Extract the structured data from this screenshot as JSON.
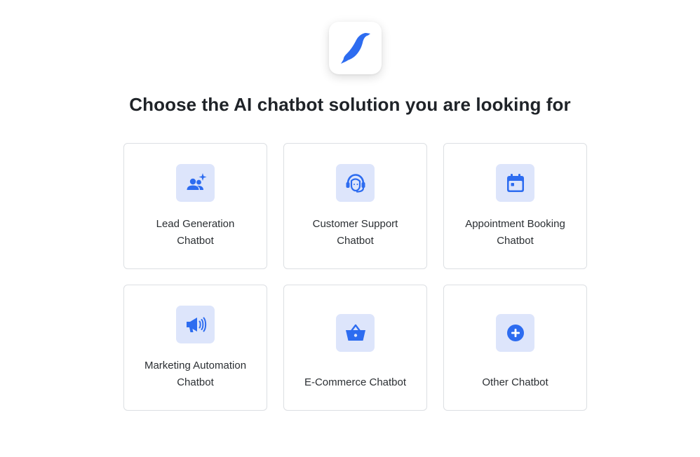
{
  "brand": {
    "accent_color": "#2d6cf0",
    "icon_tile_bg": "#dde5fb",
    "logo_icon": "bird-logo-icon"
  },
  "headline": "Choose the AI chatbot solution you are looking for",
  "options": [
    {
      "label_line1": "Lead Generation",
      "label_line2": "Chatbot",
      "icon": "users-sparkle-icon"
    },
    {
      "label_line1": "Customer Support",
      "label_line2": "Chatbot",
      "icon": "headset-agent-icon"
    },
    {
      "label_line1": "Appointment Booking",
      "label_line2": "Chatbot",
      "icon": "calendar-icon"
    },
    {
      "label_line1": "Marketing Automation",
      "label_line2": "Chatbot",
      "icon": "megaphone-icon"
    },
    {
      "label_line1": "E-Commerce Chatbot",
      "label_line2": "",
      "icon": "shopping-basket-icon"
    },
    {
      "label_line1": "Other Chatbot",
      "label_line2": "",
      "icon": "plus-circle-icon"
    }
  ]
}
